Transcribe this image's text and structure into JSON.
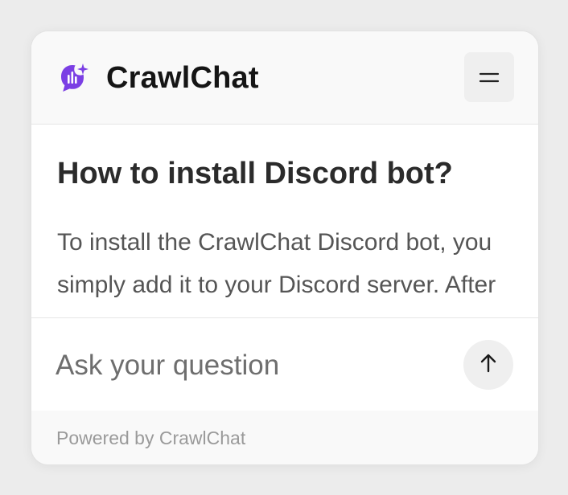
{
  "header": {
    "brand_name": "CrawlChat",
    "logo_icon": "crawlchat-logo-icon",
    "menu_icon": "menu-icon"
  },
  "conversation": {
    "question": "How to install Discord bot?",
    "answer": "To install the CrawlChat Discord bot, you simply add it to your Discord server. After adding it, you"
  },
  "composer": {
    "placeholder": "Ask your question",
    "send_icon": "arrow-up-icon"
  },
  "footer": {
    "powered_by": "Powered by CrawlChat"
  },
  "colors": {
    "brand_purple": "#7b3fe4",
    "card_background": "#ffffff",
    "header_background": "#f9f9f9",
    "page_background": "#ececec"
  }
}
